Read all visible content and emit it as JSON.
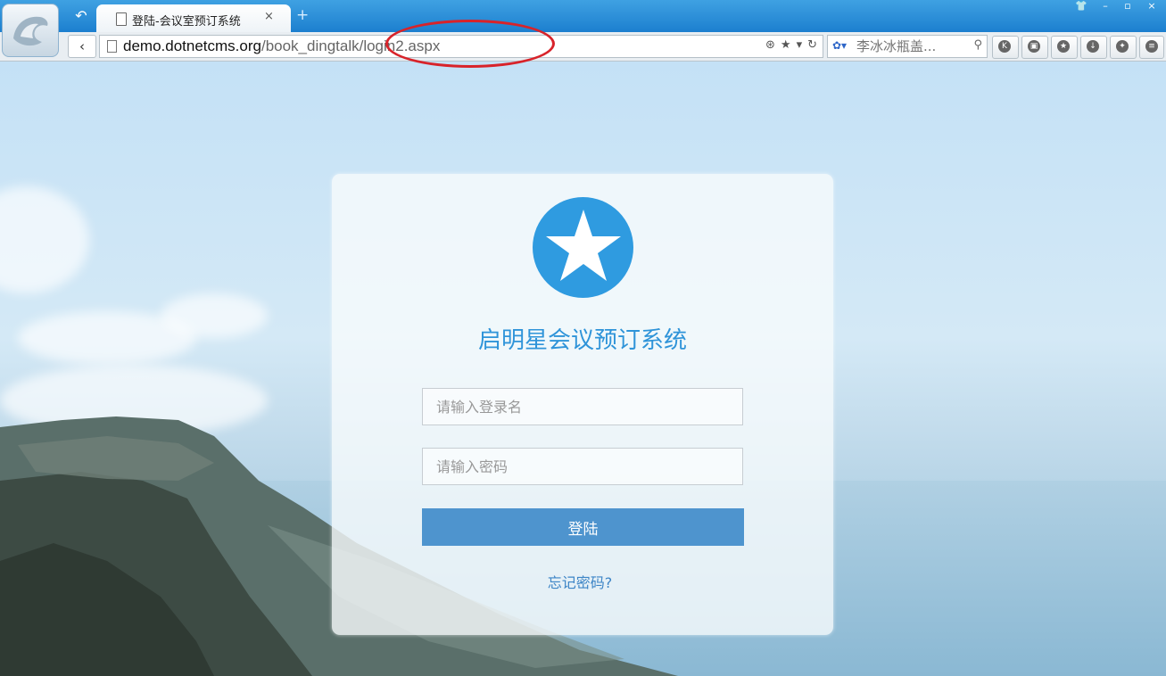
{
  "browser": {
    "tab_title": "登陆-会议室预订系统",
    "tab_close": "×",
    "new_tab": "+",
    "url_host": "demo.dotnetcms.org",
    "url_path": "/book_dingtalk/login2.aspx",
    "search_placeholder": "李冰冰瓶盖...",
    "window_controls": [
      "👕",
      "–",
      "▫",
      "×"
    ]
  },
  "login": {
    "system_title": "启明星会议预订系统",
    "username_placeholder": "请输入登录名",
    "password_placeholder": "请输入密码",
    "login_button": "登陆",
    "forgot_link": "忘记密码?"
  },
  "colors": {
    "accent": "#2f9be0",
    "button": "#4e94ce",
    "annotation": "#d8232a"
  }
}
